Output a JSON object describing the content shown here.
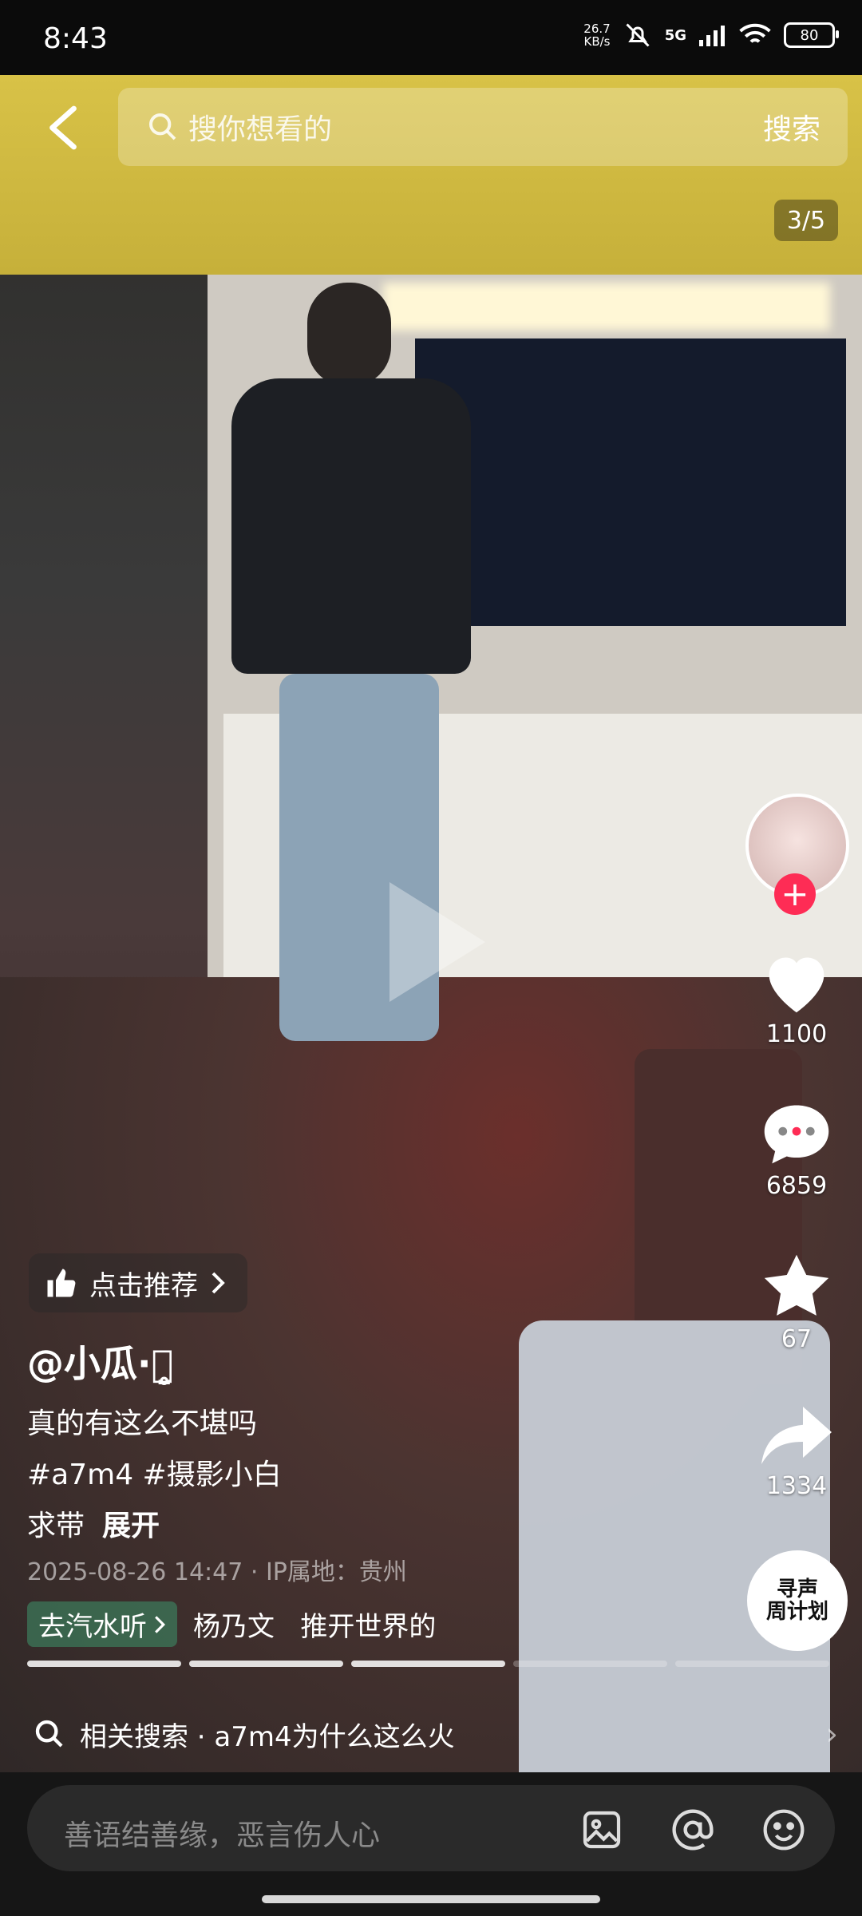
{
  "status_bar": {
    "time": "8:43",
    "net_speed_value": "26.7",
    "net_speed_unit": "KB/s",
    "network": "5G",
    "battery": "80"
  },
  "search": {
    "placeholder": "搜你想看的",
    "button": "搜索"
  },
  "photo_counter": "3/5",
  "actions": {
    "like_count": "1100",
    "comment_count": "6859",
    "favorite_count": "67",
    "share_count": "1334"
  },
  "follow_symbol": "+",
  "music_disc_text": "寻声\n周计划",
  "recommend_label": "点击推荐",
  "author": "@小瓜·ꪔ̤̥",
  "description": {
    "line1": "真的有这么不堪吗",
    "line2": "#a7m4 #摄影小白",
    "line3": "求带",
    "expand": "展开"
  },
  "meta": "2025-08-26 14:47 · IP属地：贵州",
  "music": {
    "qishui_label": "去汽水听",
    "song_text": "杨乃文   推开世界的"
  },
  "progress": {
    "total_segments": 5,
    "current_index": 3
  },
  "related_search": "相关搜索 · a7m4为什么这么火",
  "comment_placeholder": "善语结善缘，恶言伤人心",
  "colors": {
    "accent": "#fe2c55",
    "tent_yellow": "#d8c247",
    "bottom_bg": "#161616"
  }
}
